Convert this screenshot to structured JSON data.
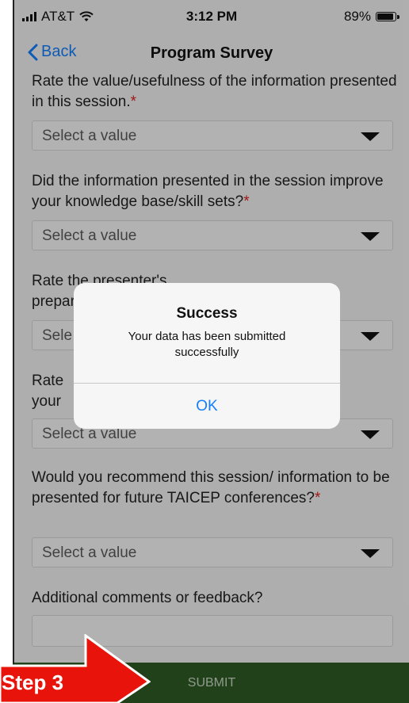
{
  "status_bar": {
    "carrier": "AT&T",
    "time": "3:12 PM",
    "battery": "89%",
    "battery_level": 0.89
  },
  "nav": {
    "back_label": "Back",
    "title": "Program Survey"
  },
  "questions": [
    {
      "text": "Rate the value/usefulness of the information presented in this session.",
      "required": "*",
      "select_value": "Select a value"
    },
    {
      "text": "Did the information presented in the session improve your knowledge base/skill sets?",
      "required": "*",
      "select_value": "Select a value"
    },
    {
      "text": "Rate the presenter's preparation and organ",
      "required": "",
      "select_value": "Sele"
    },
    {
      "text": "Rate your",
      "required": "",
      "select_value": "Select a value"
    },
    {
      "text": "Would you recommend this session/ information to be presented for future TAICEP conferences?",
      "required": "*",
      "select_value": "Select a value"
    },
    {
      "text": "Additional comments or feedback?",
      "required": ""
    }
  ],
  "submit_label": "SUBMIT",
  "alert": {
    "title": "Success",
    "message": "Your data has been submitted successfully",
    "ok_label": "OK"
  },
  "annotation": {
    "label": "Step 3",
    "color": "#e8140c"
  },
  "colors": {
    "accent": "#147efb",
    "submit_bar": "#2f5a24",
    "required": "#e02020"
  }
}
